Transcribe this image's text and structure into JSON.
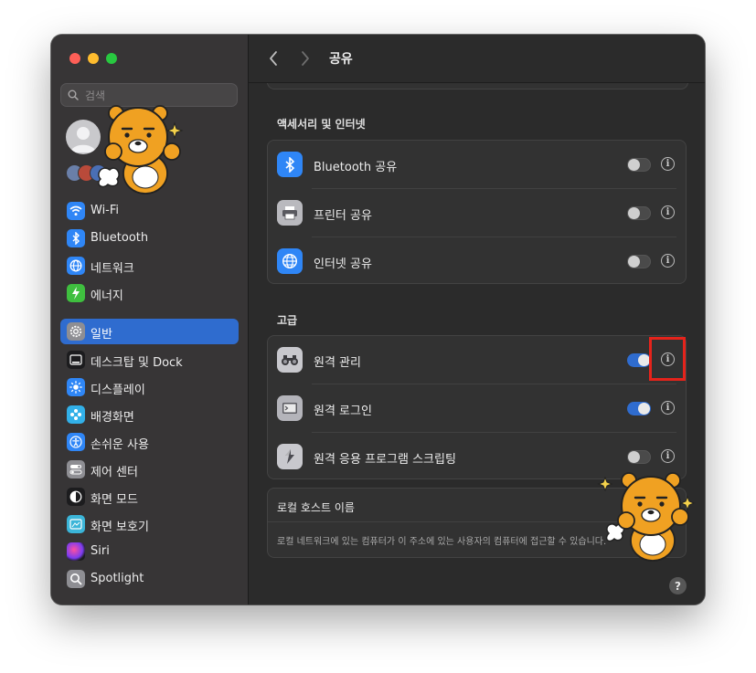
{
  "window": {
    "title": "공유"
  },
  "search": {
    "placeholder": "검색"
  },
  "sidebar": {
    "items": [
      {
        "label": "Wi-Fi",
        "icon": "wifi-icon",
        "color": "#2f86f6"
      },
      {
        "label": "Bluetooth",
        "icon": "bluetooth-icon",
        "color": "#2f86f6"
      },
      {
        "label": "네트워크",
        "icon": "globe-icon",
        "color": "#2f86f6"
      },
      {
        "label": "에너지",
        "icon": "energy-icon",
        "color": "#3fbf3f"
      },
      {
        "label": "일반",
        "icon": "gear-icon",
        "color": "#8e8e93",
        "active": true
      },
      {
        "label": "데스크탑 및 Dock",
        "icon": "dock-icon",
        "color": "#1c1c1e"
      },
      {
        "label": "디스플레이",
        "icon": "sun-icon",
        "color": "#2f86f6"
      },
      {
        "label": "배경화면",
        "icon": "wallpaper-icon",
        "color": "#32b0e8"
      },
      {
        "label": "손쉬운 사용",
        "icon": "accessibility-icon",
        "color": "#2f86f6"
      },
      {
        "label": "제어 센터",
        "icon": "control-center-icon",
        "color": "#8e8e93"
      },
      {
        "label": "화면 모드",
        "icon": "appearance-icon",
        "color": "#1c1c1e"
      },
      {
        "label": "화면 보호기",
        "icon": "screensaver-icon",
        "color": "#3bb5d8"
      },
      {
        "label": "Siri",
        "icon": "siri-icon",
        "color": "#1c1c1e"
      },
      {
        "label": "Spotlight",
        "icon": "magnifier-icon",
        "color": "#8e8e93"
      }
    ]
  },
  "sections": {
    "accessories": {
      "title": "액세서리 및 인터넷",
      "rows": [
        {
          "label": "Bluetooth 공유",
          "icon": "bluetooth-share-icon",
          "enabled": false
        },
        {
          "label": "프린터 공유",
          "icon": "printer-icon",
          "enabled": false
        },
        {
          "label": "인터넷 공유",
          "icon": "internet-share-icon",
          "enabled": false
        }
      ]
    },
    "advanced": {
      "title": "고급",
      "rows": [
        {
          "label": "원격 관리",
          "icon": "binoculars-icon",
          "enabled": true
        },
        {
          "label": "원격 로그인",
          "icon": "remote-login-icon",
          "enabled": true
        },
        {
          "label": "원격 응용 프로그램 스크립팅",
          "icon": "script-icon",
          "enabled": false
        }
      ]
    }
  },
  "host": {
    "label": "로컬 호스트 이름",
    "description": "로컬 네트워크에 있는 컴퓨터가 이 주소에 있는 사용자의 컴퓨터에 접근할 수 있습니다."
  },
  "help": {
    "label": "?"
  },
  "info_glyph": "i"
}
